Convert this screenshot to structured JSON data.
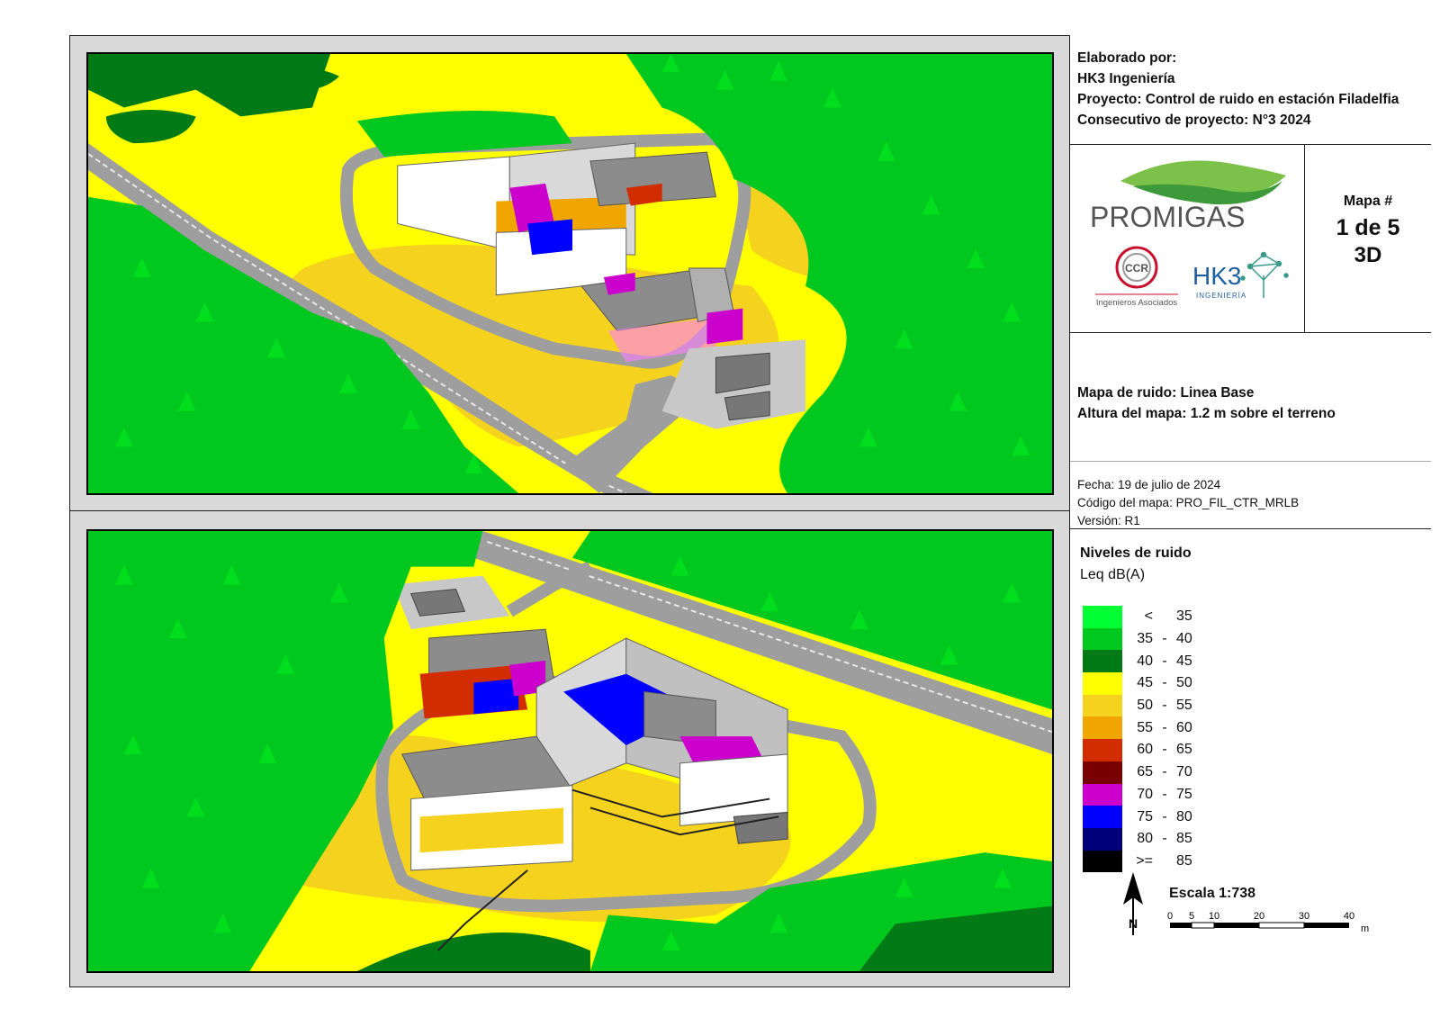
{
  "header": {
    "made_by_label": "Elaborado por:",
    "company": "HK3 Ingeniería",
    "project": "Proyecto: Control de ruido en estación Filadelfia",
    "project_number": "Consecutivo de proyecto: N°3 2024"
  },
  "logos": {
    "promigas": "PROMIGAS",
    "ccr": "CCR",
    "ccr_subtitle": "Ingenieros Asociados",
    "hk3": "HK3",
    "hk3_subtitle": "INGENIERÍA"
  },
  "map_number": {
    "label": "Mapa #",
    "value": "1 de 5",
    "type": "3D"
  },
  "description": {
    "map_name": "Mapa de ruido: Linea Base",
    "height": "Altura del mapa: 1.2 m sobre el terreno"
  },
  "metadata": {
    "date": "Fecha: 19 de julio de 2024",
    "code": "Código del mapa: PRO_FIL_CTR_MRLB",
    "version": "Versión: R1"
  },
  "legend": {
    "title": "Niveles de ruido",
    "unit": "Leq dB(A)",
    "items": [
      {
        "lo": "<",
        "dash": "",
        "hi": "35",
        "color": "#00ff33"
      },
      {
        "lo": "35",
        "dash": "-",
        "hi": "40",
        "color": "#00c81e"
      },
      {
        "lo": "40",
        "dash": "-",
        "hi": "45",
        "color": "#007a14"
      },
      {
        "lo": "45",
        "dash": "-",
        "hi": "50",
        "color": "#ffff00"
      },
      {
        "lo": "50",
        "dash": "-",
        "hi": "55",
        "color": "#f5d21e"
      },
      {
        "lo": "55",
        "dash": "-",
        "hi": "60",
        "color": "#f0a500"
      },
      {
        "lo": "60",
        "dash": "-",
        "hi": "65",
        "color": "#d22d00"
      },
      {
        "lo": "65",
        "dash": "-",
        "hi": "70",
        "color": "#780000"
      },
      {
        "lo": "70",
        "dash": "-",
        "hi": "75",
        "color": "#cc00cc"
      },
      {
        "lo": "75",
        "dash": "-",
        "hi": "80",
        "color": "#0000ff"
      },
      {
        "lo": "80",
        "dash": "-",
        "hi": "85",
        "color": "#00007a"
      },
      {
        "lo": ">=",
        "dash": "",
        "hi": "85",
        "color": "#000000"
      }
    ]
  },
  "north_arrow": "N",
  "scale": {
    "title": "Escala 1:738",
    "ticks": [
      "0",
      "5",
      "10",
      "20",
      "30",
      "40"
    ],
    "unit": "m"
  }
}
